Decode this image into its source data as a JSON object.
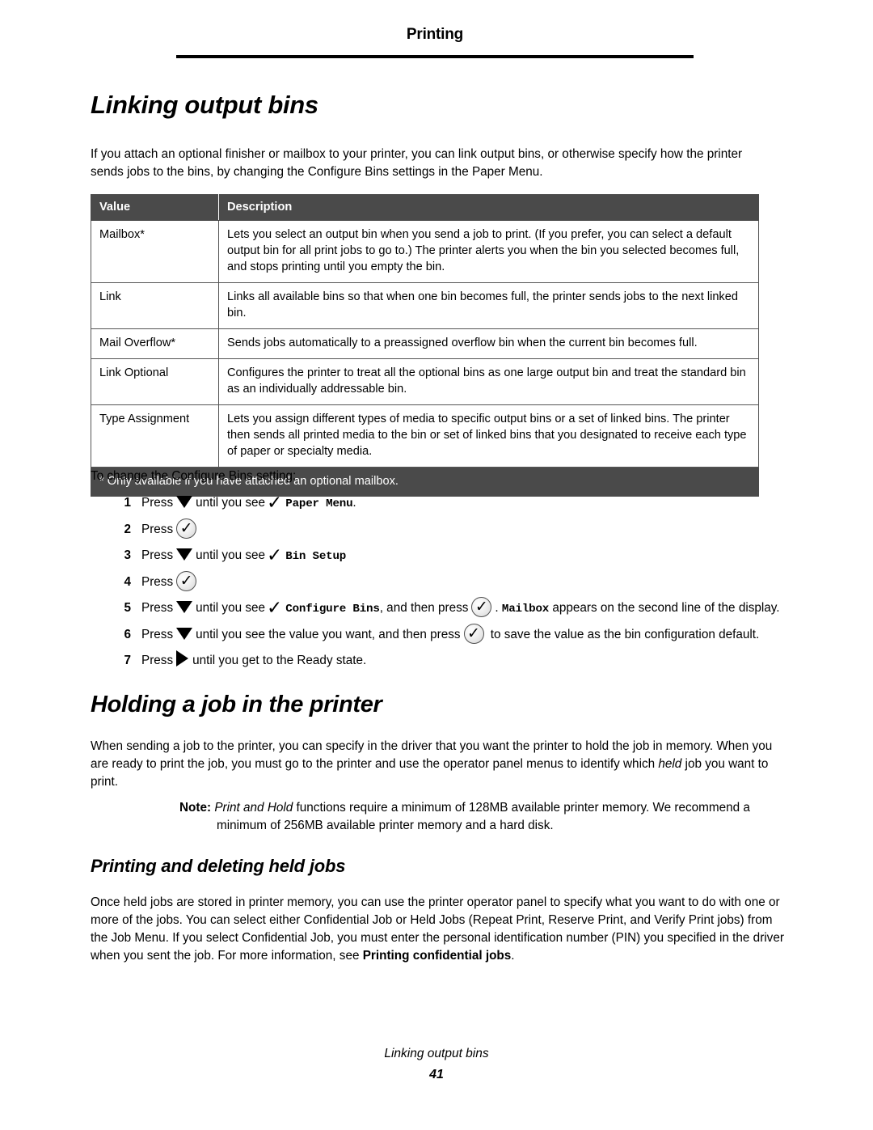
{
  "header": {
    "running_title": "Printing"
  },
  "sections": {
    "linking_output_bins": {
      "title": "Linking output bins",
      "intro": "If you attach an optional finisher or mailbox to your printer, you can link output bins, or otherwise specify how the printer sends jobs to the bins, by changing the Configure Bins settings in the Paper Menu.",
      "lead_in": "To change the Configure Bins setting:"
    },
    "holding_job": {
      "title": "Holding a job in the printer",
      "paragraph_1": "When sending a job to the printer, you can specify in the driver that you want the printer to hold the job in memory. When you are ready to print the job, you must go to the printer and use the operator panel menus to identify which ",
      "paragraph_1_italic": "held",
      "paragraph_1_end": " job you want to print.",
      "note_label": "Note:",
      "note_italic": "Print and Hold",
      "note_text": " functions require a minimum of 128MB available printer memory. We recommend a minimum of 256MB available printer memory and a hard disk."
    },
    "printing_deleting": {
      "title": "Printing and deleting held jobs",
      "paragraph": "Once held jobs are stored in printer memory, you can use the printer operator panel to specify what you want to do with one or more of the jobs. You can select either Confidential Job or Held Jobs (Repeat Print, Reserve Print, and Verify Print jobs) from the Job Menu. If you select Confidential Job, you must enter the personal identification number (PIN) you specified in the driver when you sent the job. For more information, see ",
      "paragraph_bold": "Printing confidential jobs",
      "paragraph_end": "."
    }
  },
  "table": {
    "columns": [
      "Value",
      "Description"
    ],
    "rows": [
      {
        "value": "Mailbox*",
        "description": "Lets you select an output bin when you send a job to print. (If you prefer, you can select a default output bin for all print jobs to go to.) The printer alerts you when the bin you selected becomes full, and stops printing until you empty the bin."
      },
      {
        "value": "Link",
        "description": "Links all available bins so that when one bin becomes full, the printer sends jobs to the next linked bin."
      },
      {
        "value": "Mail Overflow*",
        "description": "Sends jobs automatically to a preassigned overflow bin when the current bin becomes full."
      },
      {
        "value": "Link Optional",
        "description": "Configures the printer to treat all the optional bins as one large output bin and treat the standard bin as an individually addressable bin."
      },
      {
        "value": "Type Assignment",
        "description": "Lets you assign different types of media to specific output bins or a set of linked bins. The printer then sends all printed media to the bin or set of linked bins that you designated to receive each type of paper or specialty media."
      }
    ],
    "footnote": "* Only available if you have attached an optional mailbox.",
    "header_bg": "#4a4a4a",
    "header_fg": "#ffffff"
  },
  "steps": [
    {
      "num": "1",
      "press_label": "Press",
      "icon_1": "down-triangle-icon",
      "text_1": "until you see",
      "icon_2": "checkmark-icon",
      "mono_1": "Paper Menu",
      "text_2": "."
    },
    {
      "num": "2",
      "press_label": "Press",
      "icon_1": "select-button-icon"
    },
    {
      "num": "3",
      "press_label": "Press",
      "icon_1": "down-triangle-icon",
      "text_1": "until you see",
      "icon_2": "checkmark-icon",
      "mono_1": "Bin Setup"
    },
    {
      "num": "4",
      "press_label": "Press",
      "icon_1": "select-button-icon"
    },
    {
      "num": "5",
      "press_label": "Press",
      "icon_1": "down-triangle-icon",
      "text_1": "until you see",
      "icon_2": "checkmark-icon",
      "mono_1": "Configure Bins",
      "text_2": ", and then press",
      "icon_3": "select-button-icon",
      "text_3": ".",
      "mono_2": "Mailbox",
      "text_4": "appears on the second line of the display."
    },
    {
      "num": "6",
      "press_label": "Press",
      "icon_1": "down-triangle-icon",
      "text_1": "until you see the value you want, and then press",
      "icon_2": "select-button-icon",
      "text_2": "to save the value as the bin configuration default."
    },
    {
      "num": "7",
      "press_label": "Press",
      "icon_1": "right-triangle-icon",
      "text_1": "until you get to the Ready state."
    }
  ],
  "footer": {
    "title": "Linking output bins",
    "page_number": "41"
  }
}
